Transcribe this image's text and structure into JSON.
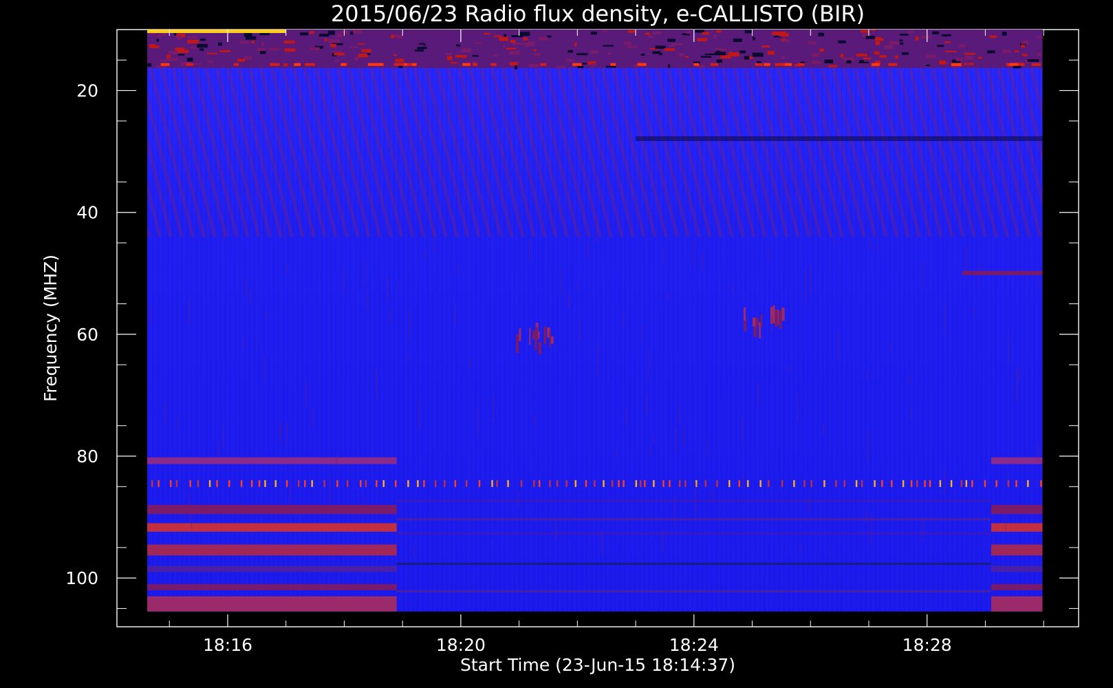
{
  "chart_data": {
    "type": "heatmap",
    "title": "2015/06/23  Radio flux density, e-CALLISTO (BIR)",
    "xlabel": "Start Time (23-Jun-15 18:14:37)",
    "ylabel": "Frequency (MHZ)",
    "x_ticks": [
      "18:16",
      "18:20",
      "18:24",
      "18:28"
    ],
    "x_tick_minutes": [
      16,
      20,
      24,
      28
    ],
    "y_ticks": [
      20,
      40,
      60,
      80,
      100
    ],
    "xlim_minutes": [
      14.1,
      30.6
    ],
    "ylim_mhz": [
      10,
      108
    ],
    "data_extent": {
      "time_start_minutes": 14.62,
      "time_end_minutes": 29.98,
      "freq_min_mhz": 10,
      "freq_max_mhz": 105.5
    },
    "colormap": [
      "#000000",
      "#2020ff",
      "#7a1a6a",
      "#ff2000",
      "#ffff60"
    ],
    "background_color": "#1c1cfa",
    "features": [
      {
        "label": "bright RFI band near top",
        "freq_mhz": [
          10,
          16
        ],
        "intensity": "high"
      },
      {
        "label": "periodic interference train",
        "freq_mhz": 84.5,
        "time_minutes": [
          14.62,
          29.98
        ]
      },
      {
        "label": "horizontal bands",
        "freq_mhz": [
          80,
          105
        ],
        "time_minutes": [
          14.62,
          18.9
        ]
      },
      {
        "label": "horizontal bands",
        "freq_mhz": [
          80,
          105
        ],
        "time_minutes": [
          29.1,
          29.98
        ]
      },
      {
        "label": "enhanced emission patch",
        "freq_mhz": 60,
        "time_minutes": 21.3
      },
      {
        "label": "enhanced emission patch",
        "freq_mhz": 57,
        "time_minutes": 25.2
      }
    ]
  }
}
